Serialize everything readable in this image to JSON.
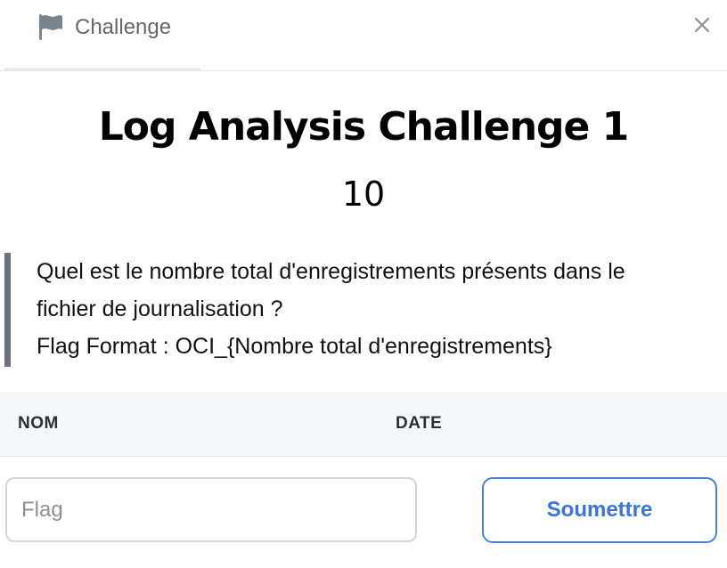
{
  "header": {
    "tab_label": "Challenge",
    "tab_icon": "flag-icon",
    "close_icon": "close-icon"
  },
  "challenge": {
    "title": "Log Analysis Challenge 1",
    "points": "10",
    "description_lines": [
      "Quel est le nombre total d'enregistrements présents dans le",
      "fichier de journalisation ?",
      "Flag Format : OCI_{Nombre total d'enregistrements}"
    ]
  },
  "table": {
    "columns": [
      "NOM",
      "DATE"
    ]
  },
  "form": {
    "flag_placeholder": "Flag",
    "flag_value": "",
    "submit_label": "Soumettre"
  },
  "colors": {
    "accent": "#3b74d6",
    "quote_bar": "#6c727a",
    "table_header_bg": "#f6f7f9"
  }
}
